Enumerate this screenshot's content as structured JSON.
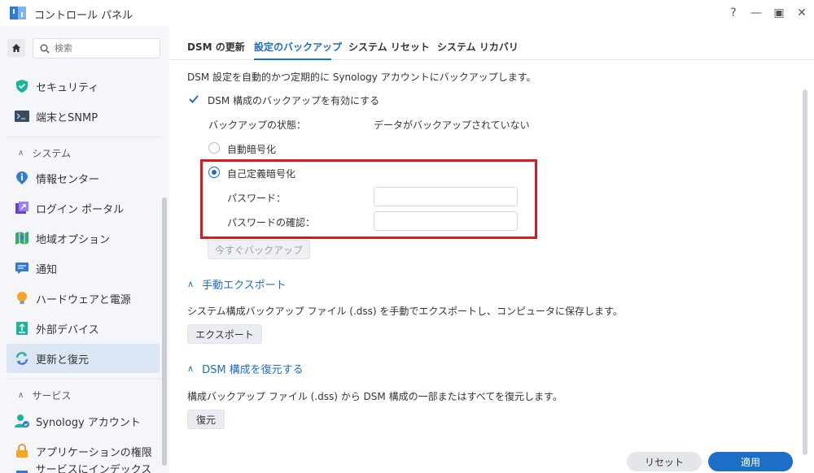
{
  "window": {
    "title": "コントロール パネル",
    "help": "?",
    "minimize": "—",
    "maximize": "▣",
    "close": "✕"
  },
  "sidebar": {
    "search_placeholder": "検索",
    "items": [
      {
        "label": "セキュリティ",
        "icon": "shield-icon"
      },
      {
        "label": "端末とSNMP",
        "icon": "terminal-icon"
      },
      {
        "label": "情報センター",
        "icon": "info-icon"
      },
      {
        "label": "ログイン ポータル",
        "icon": "portal-icon"
      },
      {
        "label": "地域オプション",
        "icon": "map-icon"
      },
      {
        "label": "通知",
        "icon": "notification-icon"
      },
      {
        "label": "ハードウェアと電源",
        "icon": "bulb-icon"
      },
      {
        "label": "外部デバイス",
        "icon": "external-device-icon"
      },
      {
        "label": "更新と復元",
        "icon": "update-icon"
      },
      {
        "label": "Synology アカウント",
        "icon": "account-icon"
      },
      {
        "label": "アプリケーションの権限",
        "icon": "lock-icon"
      },
      {
        "label": "サービスにインデックスを",
        "icon": "index-icon"
      }
    ],
    "sections": {
      "system": "システム",
      "services": "サービス"
    }
  },
  "tabs": [
    {
      "label": "DSM の更新"
    },
    {
      "label": "設定のバックアップ"
    },
    {
      "label": "システム リセット"
    },
    {
      "label": "システム リカバリ"
    }
  ],
  "backup": {
    "description": "DSM 設定を自動的かつ定期的に Synology アカウントにバックアップします。",
    "enable_label": "DSM 構成のバックアップを有効にする",
    "status_label": "バックアップの状態：",
    "status_value": "データがバックアップされていない",
    "auto_encrypt": "自動暗号化",
    "custom_encrypt": "自己定義暗号化",
    "password_label": "パスワード：",
    "password_confirm_label": "パスワードの確認：",
    "backup_now": "今すぐバックアップ"
  },
  "export": {
    "heading": "手動エクスポート",
    "description": "システム構成バックアップ ファイル (.dss) を手動でエクスポートし、コンピュータに保存します。",
    "button": "エクスポート"
  },
  "restore": {
    "heading": "DSM 構成を復元する",
    "description": "構成バックアップ ファイル (.dss) から DSM 構成の一部またはすべてを復元します。",
    "button": "復元"
  },
  "footer": {
    "reset": "リセット",
    "apply": "適用"
  },
  "colors": {
    "accent": "#1d6ec7",
    "highlight": "#d71920"
  }
}
